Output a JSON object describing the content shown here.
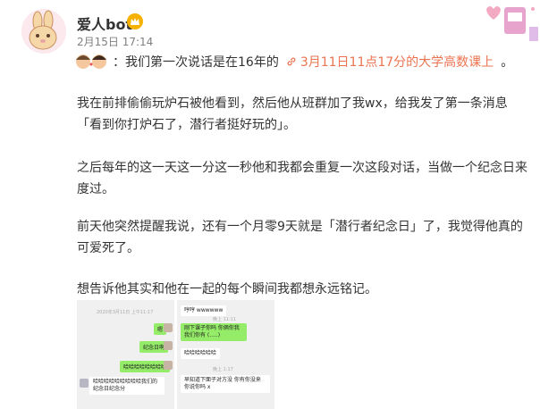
{
  "post": {
    "username": "爱人bot",
    "time": "2月15日 17:14",
    "topic_prefix": "：我们第一次说话是在16年的",
    "topic_link": "3月11日11点17分的大学高数课上",
    "topic_suffix": "。",
    "paragraphs": [
      "我在前排偷偷玩炉石被他看到，然后他从班群加了我wx，给我发了第一条消息「看到你打炉石了，潜行者挺好玩的」。",
      "之后每年的这一天这一分这一秒他和我都会重复一次这段对话，当做一个纪念日来度过。",
      "前天他突然提醒我说，还有一个月零9天就是「潜行者纪念日」了，我觉得他真的可爱死了。",
      "想告诉他其实和他在一起的每个瞬间我都想永远铭记。"
    ]
  },
  "screenshot1": {
    "time": "2020年3月11日 上午11:17",
    "messages": [
      "嗯",
      "纪念日啊",
      "哈哈哈哈哈哈哈哈",
      "哈哈哈哈哈哈哈哈哈我们的纪念日纪念分"
    ]
  },
  "screenshot2": {
    "messages": [
      "哼哼 wwwwww",
      "刚下课子你吗 你俩你我 我们你有 (.....)",
      "哈哈哈哈哈哈",
      "早知道下面子对方没 你有你没来 你说你吗 x"
    ],
    "times": [
      "晚上 11:11",
      "晚上 1:17"
    ]
  },
  "colors": {
    "link": "#eb7350",
    "text": "#333333",
    "muted": "#808080",
    "badge": "#f7b200"
  },
  "icons": [
    "bunny-avatar-icon",
    "verified-crown-icon",
    "topic-emoji-icon",
    "link-icon"
  ]
}
